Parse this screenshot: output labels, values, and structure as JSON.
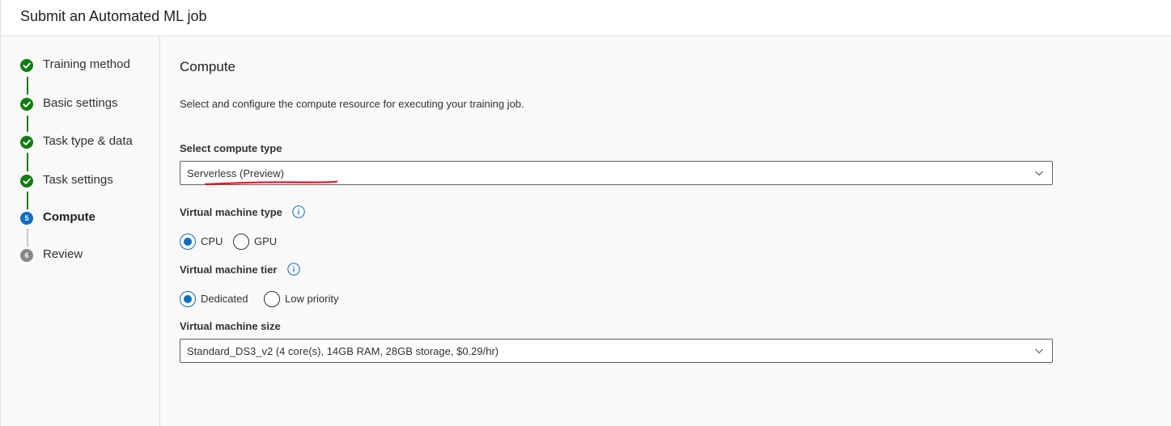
{
  "header": {
    "title": "Submit an Automated ML job"
  },
  "steps": [
    {
      "label": "Training method",
      "status": "complete"
    },
    {
      "label": "Basic settings",
      "status": "complete"
    },
    {
      "label": "Task type & data",
      "status": "complete"
    },
    {
      "label": "Task settings",
      "status": "complete"
    },
    {
      "label": "Compute",
      "status": "current",
      "number": "5"
    },
    {
      "label": "Review",
      "status": "upcoming",
      "number": "6"
    }
  ],
  "main": {
    "title": "Compute",
    "description": "Select and configure the compute resource for executing your training job.",
    "compute_type": {
      "label": "Select compute type",
      "value": "Serverless (Preview)"
    },
    "vm_type": {
      "label": "Virtual machine type",
      "options": [
        "CPU",
        "GPU"
      ],
      "selected": "CPU"
    },
    "vm_tier": {
      "label": "Virtual machine tier",
      "options": [
        "Dedicated",
        "Low priority"
      ],
      "selected": "Dedicated"
    },
    "vm_size": {
      "label": "Virtual machine size",
      "value": "Standard_DS3_v2 (4 core(s), 14GB RAM, 28GB storage, $0.29/hr)"
    }
  },
  "colors": {
    "complete": "#107c10",
    "current": "#0f6cbd",
    "upcoming": "#8a8886",
    "annotation": "#e81123"
  },
  "icons": {
    "complete": "checkmark-circle-icon",
    "info": "info-icon",
    "dropdown": "chevron-down-icon"
  }
}
